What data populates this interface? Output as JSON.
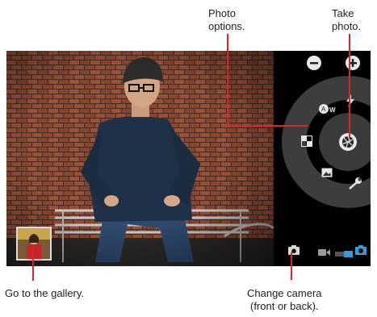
{
  "callouts": {
    "photo_options": "Photo\noptions.",
    "take_photo": "Take\nphoto.",
    "gallery": "Go to the gallery.",
    "change_camera": "Change camera\n(front or back)."
  },
  "controls": {
    "zoom_out_icon": "minus-icon",
    "zoom_in_icon": "plus-icon",
    "white_balance_icon": "white-balance-auto-icon",
    "white_balance_label": "AW",
    "flash_icon": "flash-icon",
    "scene_mode_icon": "scene-mode-icon",
    "shutter_icon": "shutter-icon",
    "effects_icon": "picture-effects-icon",
    "settings_icon": "wrench-icon",
    "switch_camera_icon": "switch-camera-icon",
    "video_mode_icon": "video-camera-icon",
    "camera_mode_icon": "still-camera-icon"
  },
  "colors": {
    "callout_line": "#d8262a",
    "mode_accent": "#3a9ad9"
  }
}
